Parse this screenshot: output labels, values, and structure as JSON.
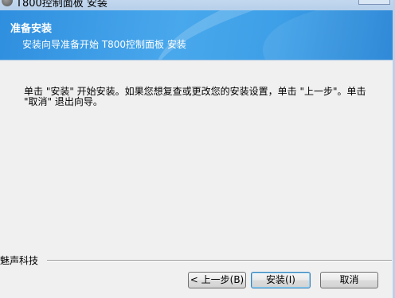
{
  "window": {
    "title": "T800控制面板 安装"
  },
  "banner": {
    "title": "准备安装",
    "subtitle": "安装向导准备开始 T800控制面板 安装"
  },
  "content": {
    "instructions": "单击 \"安装\" 开始安装。如果您想复查或更改您的安装设置，单击 \"上一步\"。单击 \"取消\" 退出向导。"
  },
  "branding": {
    "text": "魅声科技"
  },
  "buttons": {
    "back": "< 上一步(B)",
    "install": "安装(I)",
    "cancel": "取消"
  },
  "icons": {
    "app": "installer-icon"
  }
}
